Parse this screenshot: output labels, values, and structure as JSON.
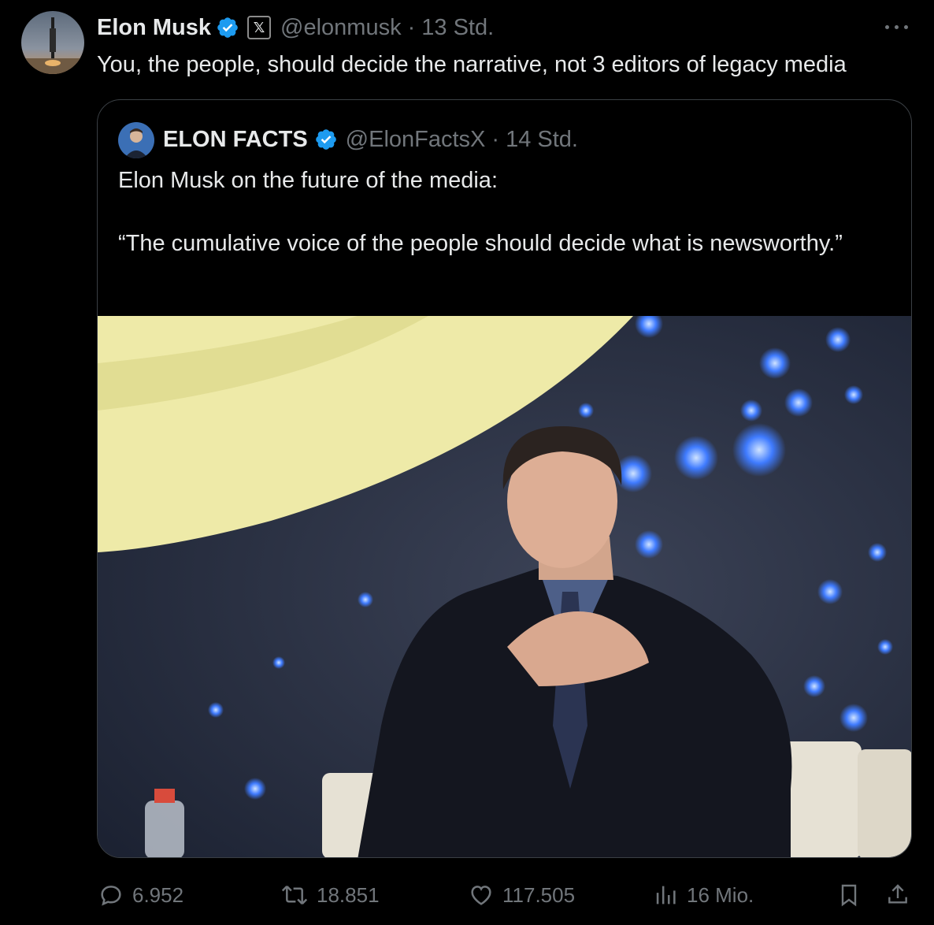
{
  "tweet": {
    "author_name": "Elon Musk",
    "x_badge": "𝕏",
    "handle": "@elonmusk",
    "separator": "·",
    "time": "13 Std.",
    "text": "You, the people, should decide the narrative, not 3 editors of legacy media"
  },
  "quoted": {
    "author_name": "ELON FACTS",
    "handle": "@ElonFactsX",
    "separator": "·",
    "time": "14 Std.",
    "text_line1": "Elon Musk on the future of the media:",
    "text_line2": "“The cumulative voice of the people should decide what is newsworthy.”"
  },
  "actions": {
    "replies": "6.952",
    "reposts": "18.851",
    "likes": "117.505",
    "views": "16 Mio."
  },
  "colors": {
    "background": "#000000",
    "text": "#e7e9ea",
    "muted": "#71767b",
    "verified": "#1d9bf0",
    "border": "#3a3f44"
  },
  "icons": [
    "verified-badge-icon",
    "more-icon",
    "reply-icon",
    "repost-icon",
    "like-icon",
    "views-icon",
    "bookmark-icon",
    "share-icon"
  ]
}
